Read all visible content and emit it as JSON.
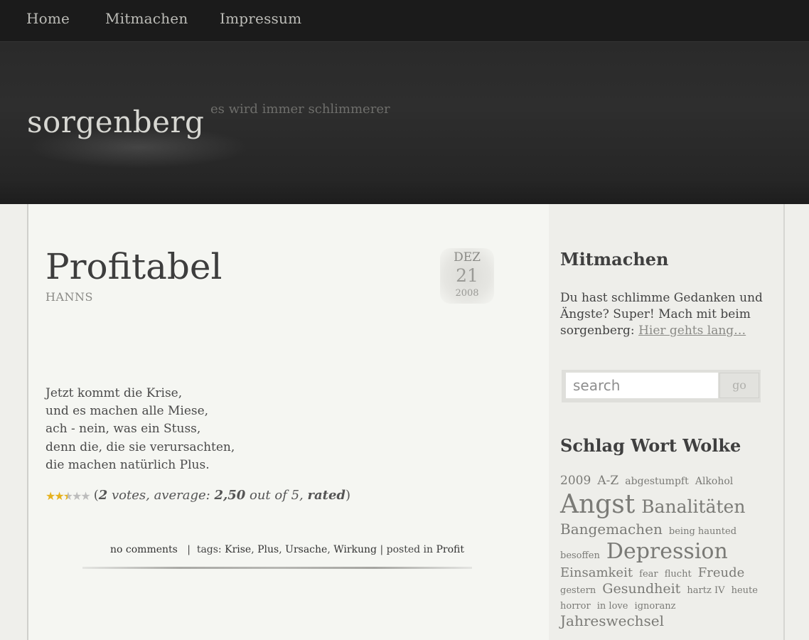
{
  "nav": {
    "items": [
      {
        "label": "Home"
      },
      {
        "label": "Mitmachen"
      },
      {
        "label": "Impressum"
      }
    ]
  },
  "header": {
    "site_title": "sorgenberg",
    "tagline": "es wird immer schlimmerer"
  },
  "post": {
    "title": "Profitabel",
    "author": "HANNS",
    "date": {
      "month": "DEZ",
      "day": "21",
      "year": "2008"
    },
    "poem": [
      "Jetzt kommt die Krise,",
      "und es machen alle Miese,",
      "ach - nein, was ein Stuss,",
      "denn die, die sie verursachten,",
      "die machen natürlich Plus."
    ],
    "rating": {
      "stars_filled": 2.5,
      "stars_total": 5,
      "open": "(",
      "votes": "2",
      "votes_text": " votes, average: ",
      "average": "2,50",
      "out_of": " out of 5, ",
      "rated": "rated",
      "close": ")"
    },
    "meta": {
      "comments": "no comments",
      "sep1": "|",
      "tags_label": "tags:",
      "tags": [
        "Krise",
        "Plus",
        "Ursache",
        "Wirkung"
      ],
      "sep2": "|",
      "posted_in_label": "posted in",
      "category": "Profit"
    }
  },
  "sidebar": {
    "mitmachen": {
      "title": "Mitmachen",
      "text": "Du hast schlimme Gedanken und Ängste? Super! Mach mit beim sorgenberg: ",
      "link": "Hier gehts lang…"
    },
    "search": {
      "placeholder": "search",
      "button": "go"
    },
    "tagcloud": {
      "title": "Schlag Wort Wolke",
      "tags": [
        {
          "label": "2009",
          "size": 17
        },
        {
          "label": "A-Z",
          "size": 17
        },
        {
          "label": "abgestumpft",
          "size": 14
        },
        {
          "label": "Alkohol",
          "size": 14
        },
        {
          "label": "Angst",
          "size": 36
        },
        {
          "label": "Banalitäten",
          "size": 25
        },
        {
          "label": "Bangemachen",
          "size": 20
        },
        {
          "label": "being haunted",
          "size": 13
        },
        {
          "label": "besoffen",
          "size": 13
        },
        {
          "label": "Depression",
          "size": 30
        },
        {
          "label": "Einsamkeit",
          "size": 18
        },
        {
          "label": "fear",
          "size": 13
        },
        {
          "label": "flucht",
          "size": 13
        },
        {
          "label": "Freude",
          "size": 18
        },
        {
          "label": "gestern",
          "size": 13
        },
        {
          "label": "Gesundheit",
          "size": 19
        },
        {
          "label": "hartz IV",
          "size": 13
        },
        {
          "label": "heute",
          "size": 13
        },
        {
          "label": "horror",
          "size": 13
        },
        {
          "label": "in love",
          "size": 13
        },
        {
          "label": "ignoranz",
          "size": 13
        },
        {
          "label": "Jahreswechsel",
          "size": 20
        }
      ]
    }
  }
}
